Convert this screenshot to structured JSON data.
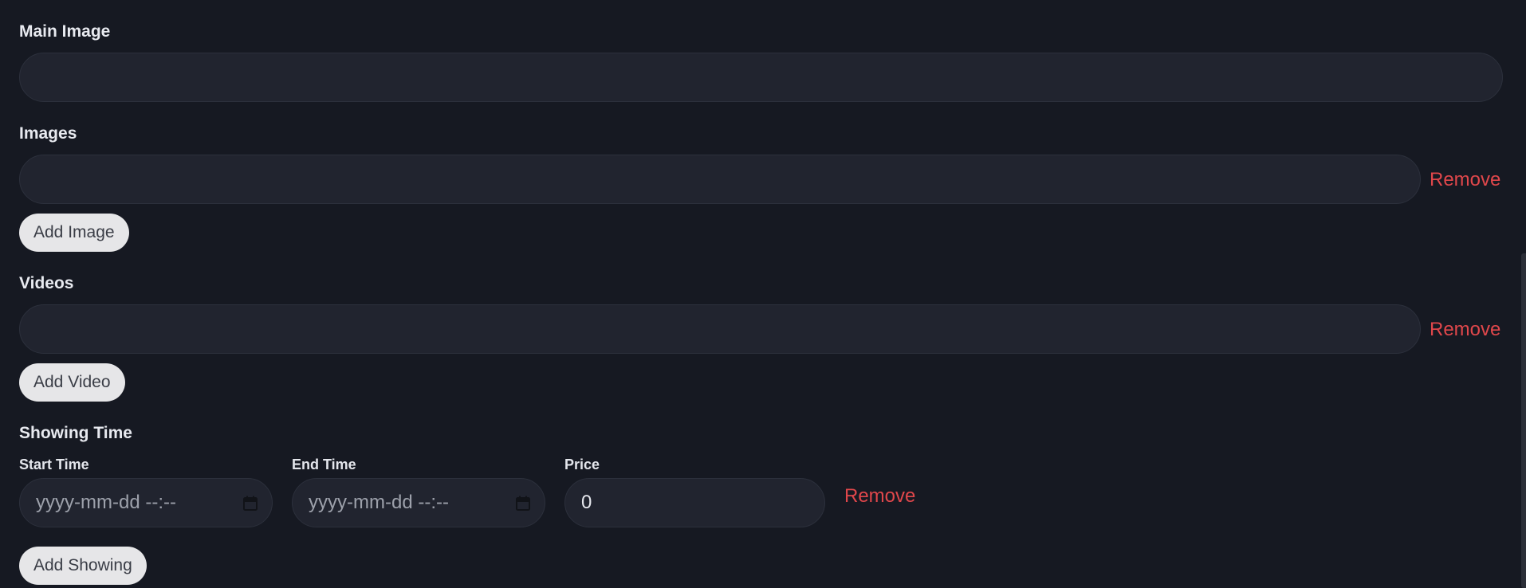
{
  "main_image": {
    "label": "Main Image",
    "value": "",
    "placeholder": ""
  },
  "images": {
    "label": "Images",
    "items": [
      {
        "value": "",
        "remove_label": "Remove"
      }
    ],
    "add_label": "Add Image"
  },
  "videos": {
    "label": "Videos",
    "items": [
      {
        "value": "",
        "remove_label": "Remove"
      }
    ],
    "add_label": "Add Video"
  },
  "showing_time": {
    "label": "Showing Time",
    "rows": [
      {
        "start_label": "Start Time",
        "start_value": "yyyy-mm-dd --:--",
        "end_label": "End Time",
        "end_value": "yyyy-mm-dd --:--",
        "price_label": "Price",
        "price_value": "0",
        "remove_label": "Remove"
      }
    ],
    "add_label": "Add Showing"
  },
  "colors": {
    "background": "#161922",
    "input_background": "#21242f",
    "remove_text": "#e0474b",
    "button_background": "#e6e6e8"
  },
  "icons": {
    "calendar": "calendar-icon"
  }
}
